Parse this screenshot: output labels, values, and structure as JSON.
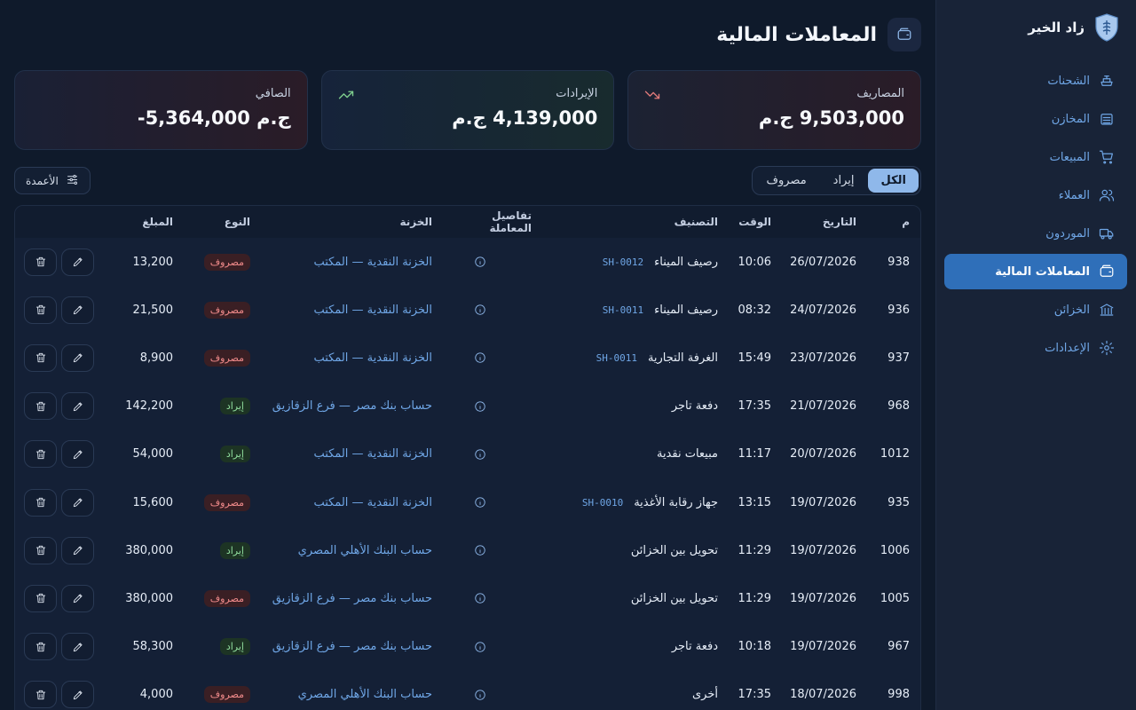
{
  "brand": {
    "name": "زاد الخير"
  },
  "sidebar": {
    "items": [
      {
        "label": "الشحنات",
        "icon": "ship-icon"
      },
      {
        "label": "المخازن",
        "icon": "warehouse-icon"
      },
      {
        "label": "المبيعات",
        "icon": "cart-icon"
      },
      {
        "label": "العملاء",
        "icon": "users-icon"
      },
      {
        "label": "الموردون",
        "icon": "truck-icon"
      },
      {
        "label": "المعاملات المالية",
        "icon": "wallet-icon",
        "active": true
      },
      {
        "label": "الخزائن",
        "icon": "bank-icon"
      },
      {
        "label": "الإعدادات",
        "icon": "gear-icon"
      }
    ]
  },
  "page": {
    "title": "المعاملات المالية",
    "icon": "wallet-icon"
  },
  "cards": {
    "expenses": {
      "label": "المصاريف",
      "value": "9,503,000 ج.م",
      "icon": "trend-down-icon",
      "color": "#e07a7a"
    },
    "revenues": {
      "label": "الإيرادات",
      "value": "4,139,000 ج.م",
      "icon": "trend-up-icon",
      "color": "#7fcf8e"
    },
    "net": {
      "label": "الصافي",
      "value": "-5,364,000 ج.م"
    }
  },
  "filters": {
    "all": "الكل",
    "income": "إيراد",
    "expense": "مصروف"
  },
  "columns_button": "الأعمدة",
  "table": {
    "headers": {
      "num": "م",
      "date": "التاريخ",
      "time": "الوقت",
      "category": "التصنيف",
      "details": "تفاصيل المعاملة",
      "treasury": "الخزنة",
      "type": "النوع",
      "amount": "المبلغ"
    },
    "rows": [
      {
        "num": "938",
        "date": "26/07/2026",
        "time": "10:06",
        "category": "رصيف الميناء",
        "ref": "SH-0012",
        "treasury": "الخزنة النقدية — المكتب",
        "type": "مصروف",
        "kind": "expense",
        "amount": "13,200"
      },
      {
        "num": "936",
        "date": "24/07/2026",
        "time": "08:32",
        "category": "رصيف الميناء",
        "ref": "SH-0011",
        "treasury": "الخزنة النقدية — المكتب",
        "type": "مصروف",
        "kind": "expense",
        "amount": "21,500"
      },
      {
        "num": "937",
        "date": "23/07/2026",
        "time": "15:49",
        "category": "الغرفة التجارية",
        "ref": "SH-0011",
        "treasury": "الخزنة النقدية — المكتب",
        "type": "مصروف",
        "kind": "expense",
        "amount": "8,900"
      },
      {
        "num": "968",
        "date": "21/07/2026",
        "time": "17:35",
        "category": "دفعة تاجر",
        "ref": "",
        "treasury": "حساب بنك مصر — فرع الزقازيق",
        "type": "إيراد",
        "kind": "income",
        "amount": "142,200"
      },
      {
        "num": "1012",
        "date": "20/07/2026",
        "time": "11:17",
        "category": "مبيعات نقدية",
        "ref": "",
        "treasury": "الخزنة النقدية — المكتب",
        "type": "إيراد",
        "kind": "income",
        "amount": "54,000"
      },
      {
        "num": "935",
        "date": "19/07/2026",
        "time": "13:15",
        "category": "جهاز رقابة الأغذية",
        "ref": "SH-0010",
        "treasury": "الخزنة النقدية — المكتب",
        "type": "مصروف",
        "kind": "expense",
        "amount": "15,600"
      },
      {
        "num": "1006",
        "date": "19/07/2026",
        "time": "11:29",
        "category": "تحويل بين الخزائن",
        "ref": "",
        "treasury": "حساب البنك الأهلي المصري",
        "type": "إيراد",
        "kind": "income",
        "amount": "380,000"
      },
      {
        "num": "1005",
        "date": "19/07/2026",
        "time": "11:29",
        "category": "تحويل بين الخزائن",
        "ref": "",
        "treasury": "حساب بنك مصر — فرع الزقازيق",
        "type": "مصروف",
        "kind": "expense",
        "amount": "380,000"
      },
      {
        "num": "967",
        "date": "19/07/2026",
        "time": "10:18",
        "category": "دفعة تاجر",
        "ref": "",
        "treasury": "حساب بنك مصر — فرع الزقازيق",
        "type": "إيراد",
        "kind": "income",
        "amount": "58,300"
      },
      {
        "num": "998",
        "date": "18/07/2026",
        "time": "17:35",
        "category": "أخرى",
        "ref": "",
        "treasury": "حساب البنك الأهلي المصري",
        "type": "مصروف",
        "kind": "expense",
        "amount": "4,000"
      }
    ]
  }
}
